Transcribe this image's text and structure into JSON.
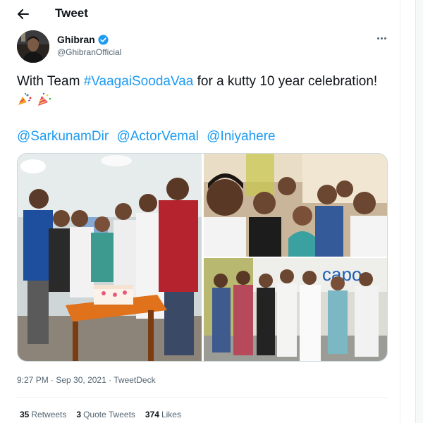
{
  "header": {
    "title": "Tweet",
    "back_icon": "arrow-left-icon"
  },
  "author": {
    "display_name": "Ghibran",
    "handle": "@GhibranOfficial",
    "verified_icon": "verified-badge-icon",
    "verified_color": "#1d9bf0"
  },
  "tweet": {
    "text_prefix": "With Team ",
    "hashtag": "#VaagaiSoodaVaa",
    "text_suffix": " for a kutty 10 year celebration!",
    "emojis": [
      "confetti-ball-icon",
      "party-popper-icon"
    ],
    "mentions": [
      "@SarkunamDir",
      "@ActorVemal",
      "@Iniyahere"
    ]
  },
  "media": {
    "photos": [
      "cake-cutting-photo",
      "group-selfie-photo",
      "group-standing-photo"
    ],
    "sign_text": "capo"
  },
  "meta": {
    "time": "9:27 PM",
    "separator": " · ",
    "date": "Sep 30, 2021",
    "source": "TweetDeck"
  },
  "stats": [
    {
      "count": "35",
      "label": "Retweets"
    },
    {
      "count": "3",
      "label": "Quote Tweets"
    },
    {
      "count": "374",
      "label": "Likes"
    }
  ],
  "colors": {
    "link": "#1d9bf0",
    "secondary_text": "#536471",
    "border": "#cfd9de"
  }
}
